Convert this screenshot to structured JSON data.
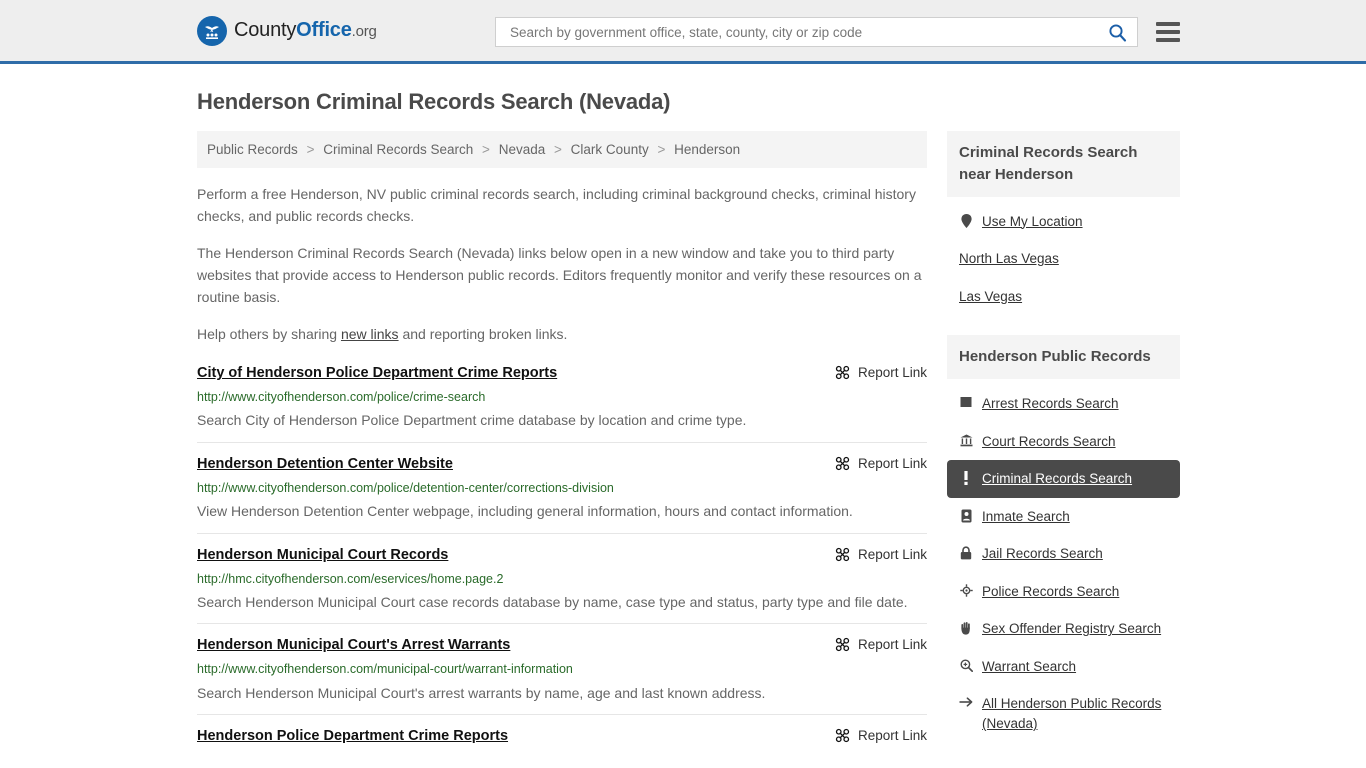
{
  "header": {
    "logo": {
      "prefix": "County",
      "bold": "Office",
      "tld": ".org",
      "icon": "eagle-emblem-icon"
    },
    "search": {
      "placeholder": "Search by government office, state, county, city or zip code",
      "value": "",
      "search_icon": "search-icon"
    },
    "menu_icon": "hamburger-menu-icon",
    "accent_color": "#2f6ca8"
  },
  "page": {
    "title": "Henderson Criminal Records Search (Nevada)"
  },
  "breadcrumb": {
    "separator": ">",
    "items": [
      {
        "label": "Public Records"
      },
      {
        "label": "Criminal Records Search"
      },
      {
        "label": "Nevada"
      },
      {
        "label": "Clark County"
      },
      {
        "label": "Henderson"
      }
    ]
  },
  "intro": {
    "p1": "Perform a free Henderson, NV public criminal records search, including criminal background checks, criminal history checks, and public records checks.",
    "p2": "The Henderson Criminal Records Search (Nevada) links below open in a new window and take you to third party websites that provide access to Henderson public records. Editors frequently monitor and verify these resources on a routine basis.",
    "p3_before": "Help others by sharing ",
    "p3_link": "new links",
    "p3_after": " and reporting broken links."
  },
  "results": {
    "report_label": "Report Link",
    "report_icon": "broken-link-icon",
    "items": [
      {
        "title": "City of Henderson Police Department Crime Reports",
        "url": "http://www.cityofhenderson.com/police/crime-search",
        "description": "Search City of Henderson Police Department crime database by location and crime type."
      },
      {
        "title": "Henderson Detention Center Website",
        "url": "http://www.cityofhenderson.com/police/detention-center/corrections-division",
        "description": "View Henderson Detention Center webpage, including general information, hours and contact information."
      },
      {
        "title": "Henderson Municipal Court Records",
        "url": "http://hmc.cityofhenderson.com/eservices/home.page.2",
        "description": "Search Henderson Municipal Court case records database by name, case type and status, party type and file date."
      },
      {
        "title": "Henderson Municipal Court's Arrest Warrants",
        "url": "http://www.cityofhenderson.com/municipal-court/warrant-information",
        "description": "Search Henderson Municipal Court's arrest warrants by name, age and last known address."
      },
      {
        "title": "Henderson Police Department Crime Reports",
        "url": "",
        "description": ""
      }
    ]
  },
  "sidebar": {
    "near_panel": {
      "title": "Criminal Records Search near Henderson",
      "items": [
        {
          "label": "Use My Location",
          "icon": "map-pin-icon"
        },
        {
          "label": "North Las Vegas",
          "icon": "none"
        },
        {
          "label": "Las Vegas",
          "icon": "none"
        }
      ]
    },
    "records_panel": {
      "title": "Henderson Public Records",
      "active_color": "#4a4a4a",
      "items": [
        {
          "label": "Arrest Records Search",
          "icon": "square-icon",
          "active": false
        },
        {
          "label": "Court Records Search",
          "icon": "courthouse-icon",
          "active": false
        },
        {
          "label": "Criminal Records Search",
          "icon": "exclamation-icon",
          "active": true
        },
        {
          "label": "Inmate Search",
          "icon": "id-badge-icon",
          "active": false
        },
        {
          "label": "Jail Records Search",
          "icon": "padlock-icon",
          "active": false
        },
        {
          "label": "Police Records Search",
          "icon": "police-badge-icon",
          "active": false
        },
        {
          "label": "Sex Offender Registry Search",
          "icon": "hand-icon",
          "active": false
        },
        {
          "label": "Warrant Search",
          "icon": "magnifier-plus-icon",
          "active": false
        },
        {
          "label": "All Henderson Public Records (Nevada)",
          "icon": "arrow-right-icon",
          "active": false
        }
      ]
    }
  }
}
